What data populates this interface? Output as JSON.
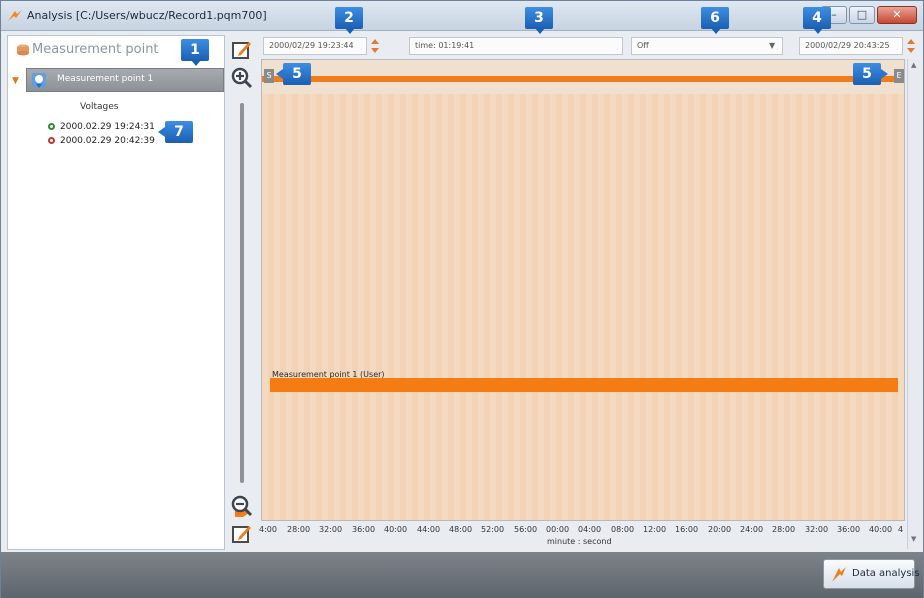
{
  "window": {
    "title": "Analysis [C:/Users/wbucz/Record1.pqm700]",
    "min_glyph": "–",
    "max_glyph": "□",
    "close_glyph": "✕"
  },
  "left_panel": {
    "title": "Measurement point",
    "tree_item": "Measurement point 1",
    "group": "Voltages",
    "events": [
      {
        "label": "2000.02.29 19:24:31",
        "color": "#2e8b2e"
      },
      {
        "label": "2000.02.29 20:42:39",
        "color": "#c0392b"
      }
    ]
  },
  "controls": {
    "start_time": "2000/02/29 19:23:44",
    "duration": "time: 01:19:41",
    "mode": "Off",
    "end_time": "2000/02/29 20:43:25"
  },
  "chart": {
    "series_label": "Measurement point 1  (User)",
    "left_handle": "S",
    "right_handle": "E",
    "x_ticks": [
      "4:00",
      "28:00",
      "32:00",
      "36:00",
      "40:00",
      "44:00",
      "48:00",
      "52:00",
      "56:00",
      "00:00",
      "04:00",
      "08:00",
      "12:00",
      "16:00",
      "20:00",
      "24:00",
      "28:00",
      "32:00",
      "36:00",
      "40:00",
      "4"
    ],
    "x_axis_title": "minute : second"
  },
  "buttons": {
    "data_analysis": "Data analysis"
  },
  "badges": [
    "1",
    "2",
    "3",
    "4",
    "5",
    "5",
    "6",
    "7"
  ],
  "colors": {
    "accent": "#f47c12",
    "chart_bg": "#f2d3b5",
    "badge": "#2a74cb"
  }
}
